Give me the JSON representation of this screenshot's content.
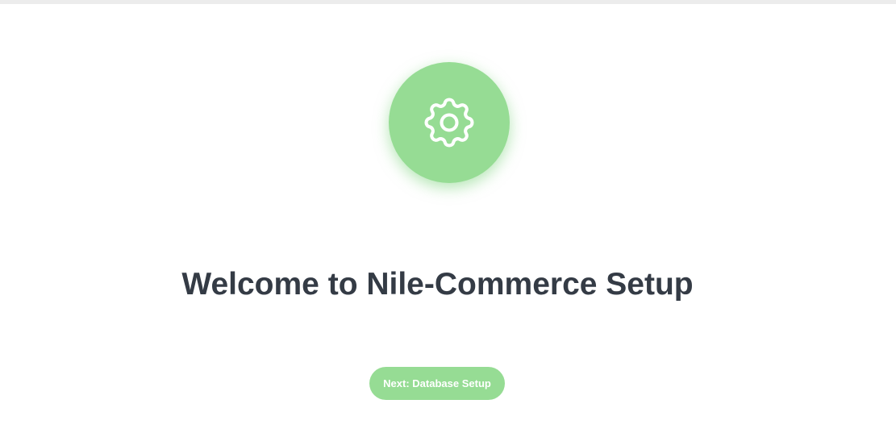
{
  "setup": {
    "title": "Welcome to Nile-Commerce Setup",
    "icon": "gear-icon",
    "next_button_label": "Next: Database Setup"
  },
  "colors": {
    "accent": "#96dc94",
    "title_text": "#343b45",
    "button_text": "#ffffff",
    "top_bar": "#ececec"
  }
}
